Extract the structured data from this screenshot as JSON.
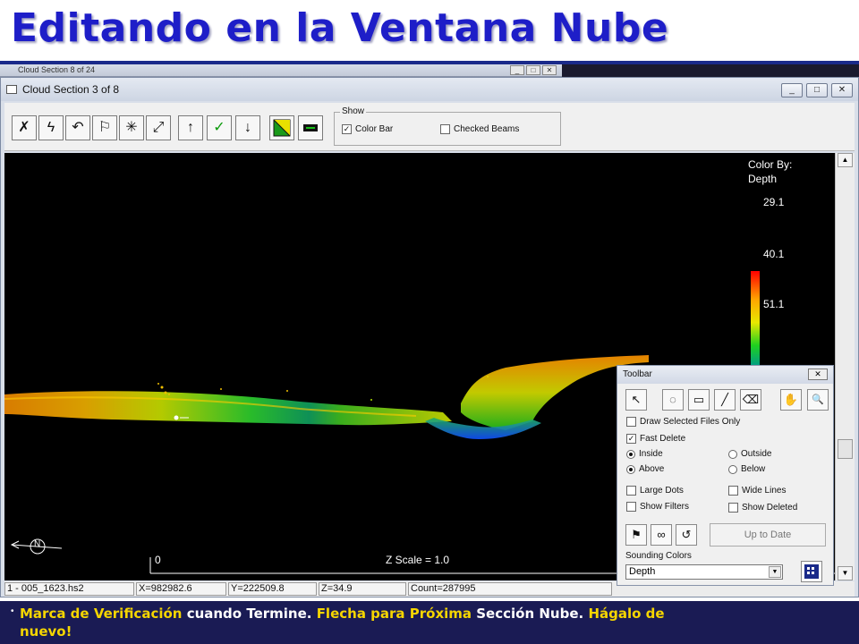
{
  "slide": {
    "title": "Editando en la Ventana Nube",
    "caption": {
      "line1": [
        {
          "text": "Marca de Verificación",
          "color": "yellow"
        },
        {
          "text": " cuando Termine.  ",
          "color": "white"
        },
        {
          "text": "Flecha para Próxima",
          "color": "yellow"
        },
        {
          "text": " Sección Nube.  ",
          "color": "white"
        },
        {
          "text": "Hágalo de",
          "color": "yellow"
        }
      ],
      "line2": [
        {
          "text": "nuevo!",
          "color": "yellow"
        }
      ]
    }
  },
  "background_window": {
    "title": "Cloud Section 8 of 24"
  },
  "window": {
    "title": "Cloud Section 3 of 8",
    "controls": {
      "minimize": "_",
      "maximize": "□",
      "close": "✕"
    }
  },
  "toolbar": {
    "buttons": [
      {
        "name": "delete-icon",
        "glyph": "✗"
      },
      {
        "name": "lightning-icon",
        "glyph": "ϟ"
      },
      {
        "name": "undo-icon",
        "glyph": "↶"
      },
      {
        "name": "flag-icon",
        "glyph": "⚐"
      },
      {
        "name": "sun-icon",
        "glyph": "✳"
      },
      {
        "name": "zoom-fit-icon",
        "glyph": "⤢"
      },
      {
        "name": "arrow-up-icon",
        "glyph": "↑"
      },
      {
        "name": "checkmark-icon",
        "glyph": "✓"
      },
      {
        "name": "arrow-down-icon",
        "glyph": "↓"
      },
      {
        "name": "color-map-icon",
        "glyph": ""
      },
      {
        "name": "beam-icon",
        "glyph": ""
      }
    ],
    "show_group": {
      "legend": "Show",
      "color_bar": {
        "label": "Color Bar",
        "checked": true
      },
      "checked_beams": {
        "label": "Checked Beams",
        "checked": false
      }
    }
  },
  "canvas": {
    "color_by_label": "Color By:",
    "color_by_value": "Depth",
    "color_bar": {
      "ticks": [
        "29.1",
        "40.1",
        "51.1"
      ],
      "colors": [
        "#ff0000",
        "#ffa500",
        "#e8e800",
        "#1fd01f",
        "#00a080",
        "#1040ff"
      ]
    },
    "scale_zero": "0",
    "z_scale": "Z Scale = 1.0",
    "north_label": "N"
  },
  "status": {
    "file": "1 - 005_1623.hs2",
    "x": "X=982982.6",
    "y": "Y=222509.8",
    "z": "Z=34.9",
    "count": "Count=287995"
  },
  "floating_toolbar": {
    "title": "Toolbar",
    "close": "✕",
    "tool_buttons": [
      {
        "name": "select-arrow-icon",
        "glyph": "↖"
      },
      {
        "name": "lasso-add-icon",
        "glyph": "◌"
      },
      {
        "name": "rectangle-add-icon",
        "glyph": "▭"
      },
      {
        "name": "line-add-icon",
        "glyph": "╱"
      },
      {
        "name": "eraser-icon",
        "glyph": "⌫"
      },
      {
        "name": "hand-pan-icon",
        "glyph": "✋"
      },
      {
        "name": "zoom-magnifier-icon",
        "glyph": "🔍"
      }
    ],
    "draw_selected_only": {
      "label": "Draw Selected Files Only",
      "checked": false
    },
    "fast_delete": {
      "label": "Fast Delete",
      "checked": true
    },
    "inside": {
      "label": "Inside",
      "selected": true
    },
    "outside": {
      "label": "Outside",
      "selected": false
    },
    "above": {
      "label": "Above",
      "selected": true
    },
    "below": {
      "label": "Below",
      "selected": false
    },
    "large_dots": {
      "label": "Large Dots",
      "checked": false
    },
    "wide_lines": {
      "label": "Wide Lines",
      "checked": false
    },
    "show_filters": {
      "label": "Show Filters",
      "checked": false
    },
    "show_deleted": {
      "label": "Show Deleted",
      "checked": false
    },
    "bottom_buttons": [
      {
        "name": "filter-flag-icon",
        "glyph": "⚑"
      },
      {
        "name": "binoculars-icon",
        "glyph": "∞"
      },
      {
        "name": "refresh-icon",
        "glyph": "↺"
      }
    ],
    "up_to_date_label": "Up to Date",
    "sounding_colors_label": "Sounding Colors",
    "sounding_colors_value": "Depth"
  }
}
